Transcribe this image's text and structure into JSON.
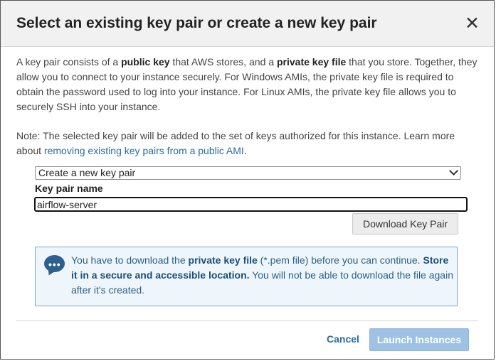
{
  "dialog": {
    "title": "Select an existing key pair or create a new key pair",
    "close_glyph": "✕"
  },
  "description": {
    "t1": "A key pair consists of a ",
    "b1": "public key",
    "t2": " that AWS stores, and a ",
    "b2": "private key file",
    "t3": " that you store. Together, they allow you to connect to your instance securely. For Windows AMIs, the private key file is required to obtain the password used to log into your instance. For Linux AMIs, the private key file allows you to securely SSH into your instance."
  },
  "note": {
    "text": "Note: The selected key pair will be added to the set of keys authorized for this instance. Learn more about ",
    "link": "removing existing key pairs from a public AMI",
    "end": "."
  },
  "key_select": {
    "selected": "Create a new key pair"
  },
  "key_name": {
    "label": "Key pair name",
    "value": "airflow-server"
  },
  "download_button": "Download Key Pair",
  "info": {
    "icon": "chat-bubble-icon",
    "t1": "You have to download the ",
    "b1": "private key file",
    "t2": " (*.pem file) before you can continue. ",
    "b2": "Store it in a secure and accessible location.",
    "t3": " You will not be able to download the file again after it's created."
  },
  "footer": {
    "cancel": "Cancel",
    "launch": "Launch Instances"
  },
  "colors": {
    "link": "#2a6aa3",
    "launch_bg": "#9dc2e6",
    "info_bg": "#eef6fb",
    "info_border": "#7aa7c7"
  }
}
